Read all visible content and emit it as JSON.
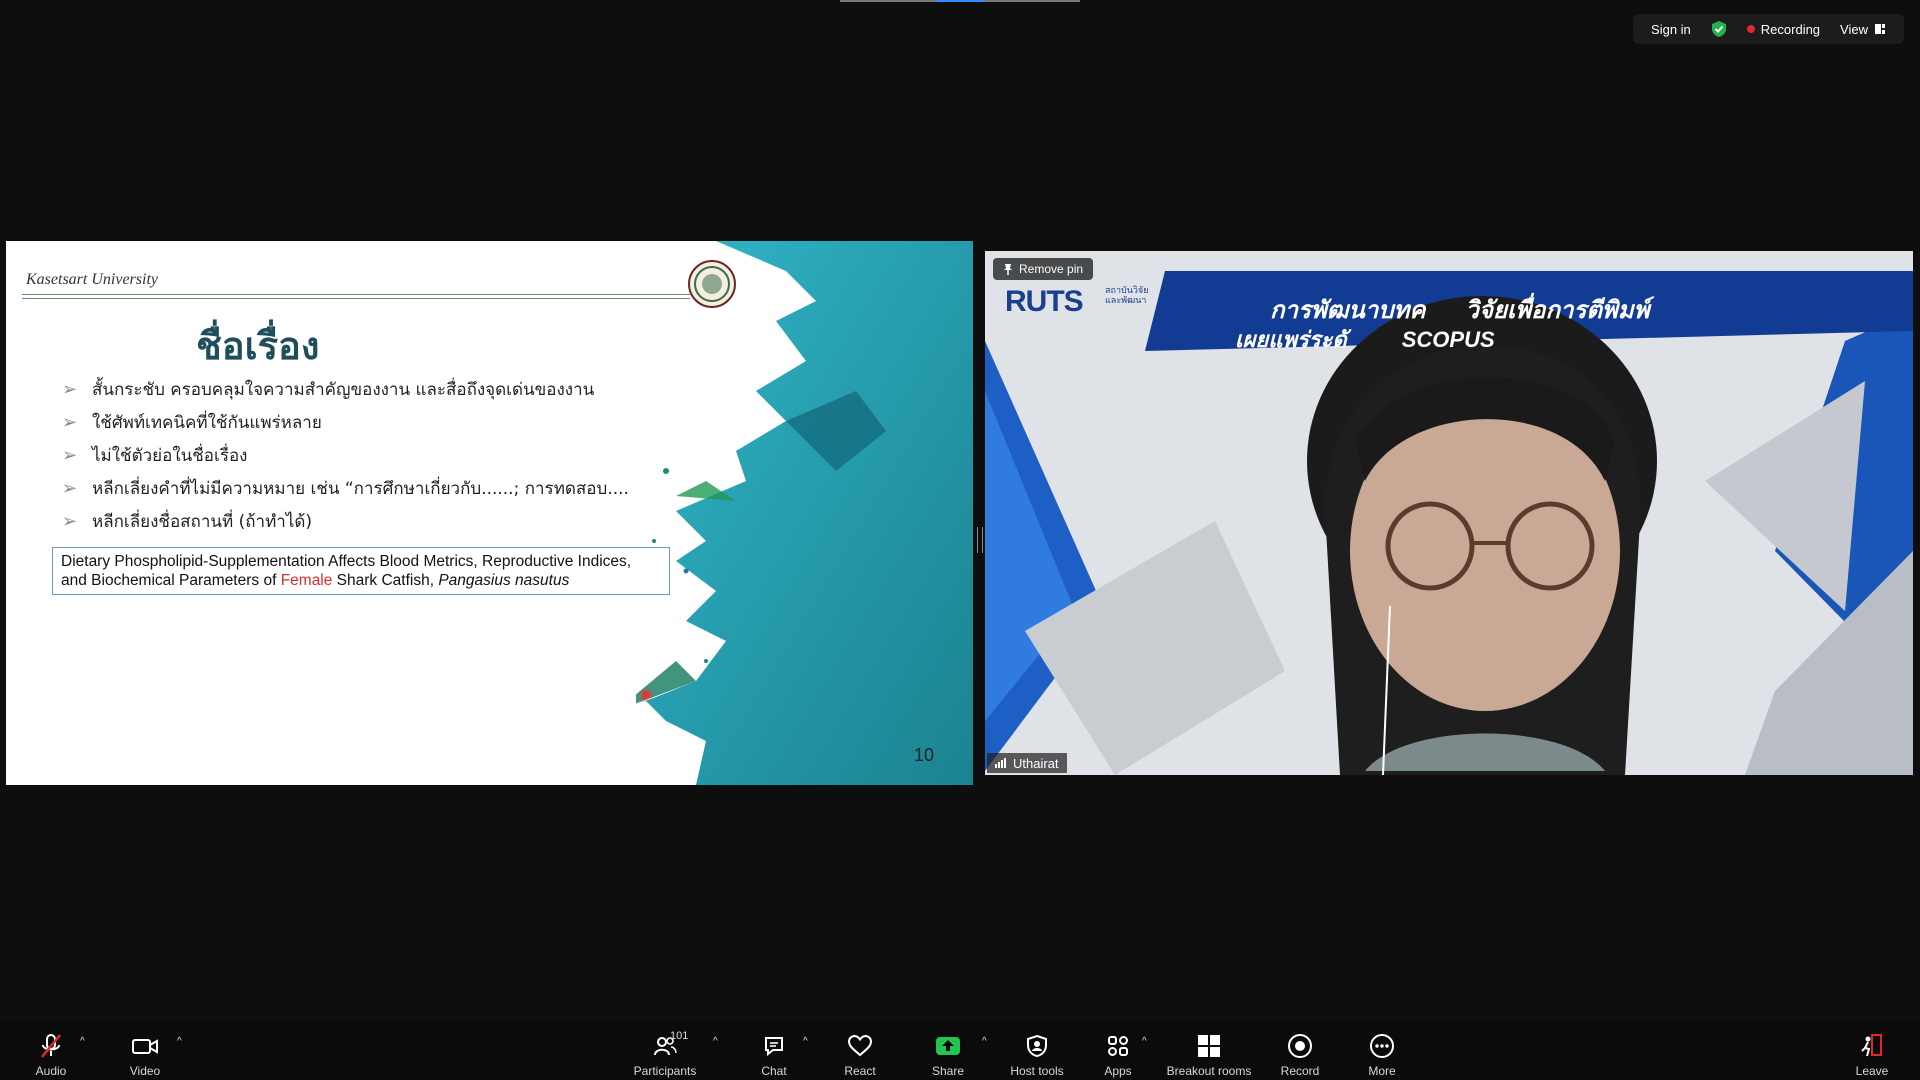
{
  "top_bar": {
    "sign_in_label": "Sign in",
    "recording_label": "Recording",
    "view_label": "View",
    "accent": "#2d8cff"
  },
  "slide": {
    "university": "Kasetsart University",
    "title": "ชื่อเรื่อง",
    "bullets": [
      "สั้นกระชับ ครอบคลุมใจความสำคัญของงาน และสื่อถึงจุดเด่นของงาน",
      "ใช้ศัพท์เทคนิคที่ใช้กันแพร่หลาย",
      "ไม่ใช้ตัวย่อในชื่อเรื่อง",
      "หลีกเลี่ยงคำที่ไม่มีความหมาย เช่น “การศึกษาเกี่ยวกับ......; การทดสอบ....",
      "หลีกเลี่ยงชื่อสถานที่ (ถ้าทำได้)"
    ],
    "example_part1": "Dietary Phospholipid-Supplementation Affects Blood Metrics, Reproductive Indices, and Biochemical Parameters of ",
    "example_highlight": "Female",
    "example_part2": " Shark Catfish, ",
    "example_italic": "Pangasius nasutus",
    "page_number": "10",
    "highlight_color": "#d32f2f"
  },
  "video_tile": {
    "remove_pin_label": "Remove pin",
    "participant_name": "Uthairat",
    "banner_logo": "RUTS",
    "banner_logo_sub": "สถาบันวิจัย และพัฒนา",
    "banner_line1": "การพัฒนาบทค      วิจัยเพื่อการตีพิมพ์",
    "banner_line2": "เผยแพร่ระดั         SCOPUS"
  },
  "toolbar": {
    "audio": "Audio",
    "video": "Video",
    "participants": "Participants",
    "participants_count": "101",
    "chat": "Chat",
    "react": "React",
    "share": "Share",
    "host_tools": "Host tools",
    "apps": "Apps",
    "breakout_rooms": "Breakout rooms",
    "record": "Record",
    "more": "More",
    "leave": "Leave"
  }
}
